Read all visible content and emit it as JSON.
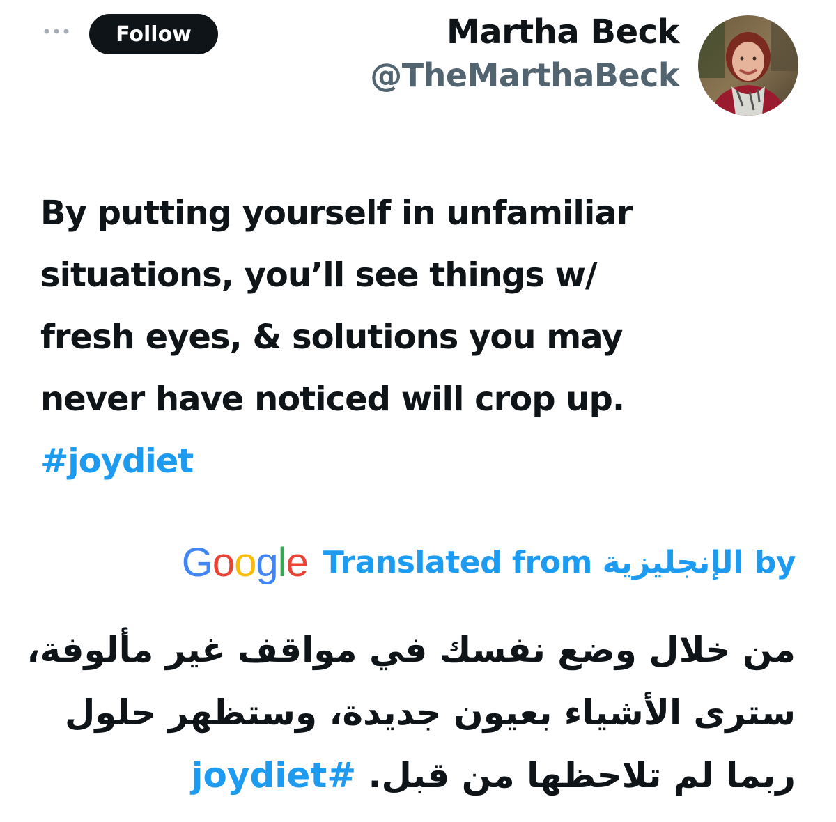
{
  "header": {
    "more_icon": "ellipsis-icon",
    "follow_label": "Follow",
    "display_name": "Martha Beck",
    "handle": "@TheMarthaBeck"
  },
  "tweet": {
    "lines": [
      "By putting yourself in unfamiliar",
      "situations, you’ll see things w/",
      "fresh eyes, & solutions you may",
      "never have noticed will crop up."
    ],
    "hashtag": "#joydiet"
  },
  "translation": {
    "google_logo_text": "Google",
    "label": "Translated from الإنجليزية by",
    "lines": [
      "من خلال وضع نفسك في مواقف غير مألوفة،",
      "سترى الأشياء بعيون جديدة، وستظهر حلول"
    ],
    "last_line_text": "ربما لم تلاحظها من قبل.",
    "hashtag": "#joydiet"
  },
  "colors": {
    "link": "#1d9bf0",
    "text": "#0f1419",
    "secondary": "#536471",
    "follow_bg": "#0f1419"
  }
}
